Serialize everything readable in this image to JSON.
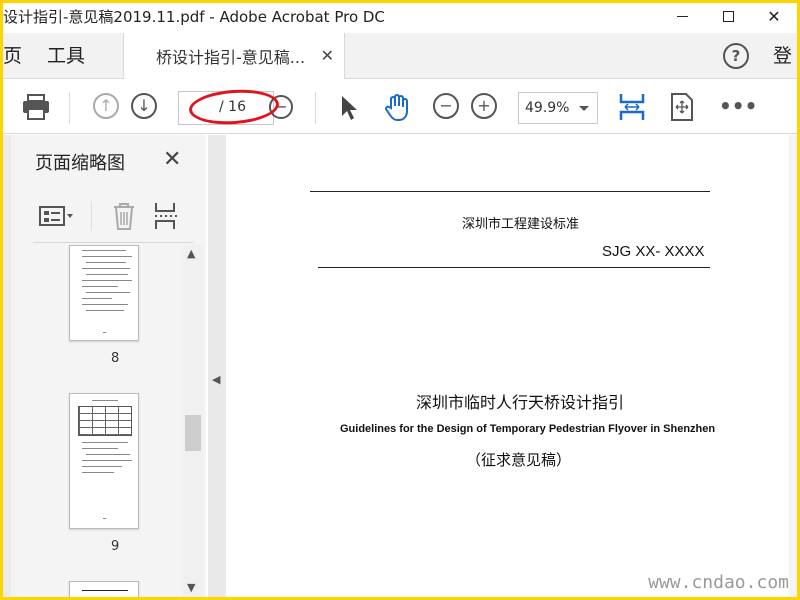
{
  "window": {
    "title": "设计指引-意见稿2019.11.pdf - Adobe Acrobat Pro DC",
    "watermark_top": "设计指引"
  },
  "tabs": {
    "home": "页",
    "tools": "工具",
    "doc_tab_label": "桥设计指引-意见稿...",
    "login": "登"
  },
  "toolbar": {
    "page_total": "/ 16",
    "zoom_value": "49.9%"
  },
  "sidebar": {
    "title": "页面缩略图",
    "pages": [
      {
        "number": "8"
      },
      {
        "number": "9"
      }
    ]
  },
  "document": {
    "standard_header": "深圳市工程建设标准",
    "standard_code": "SJG XX- XXXX",
    "main_title_cn": "深圳市临时人行天桥设计指引",
    "main_title_en": "Guidelines for the Design of Temporary Pedestrian Flyover in Shenzhen",
    "subtitle": "（征求意见稿）"
  },
  "watermark": "www.cndao.com",
  "colors": {
    "frame": "#ffd400",
    "annotation_oval": "#e0141e",
    "icon_blue": "#1b6ac9"
  }
}
